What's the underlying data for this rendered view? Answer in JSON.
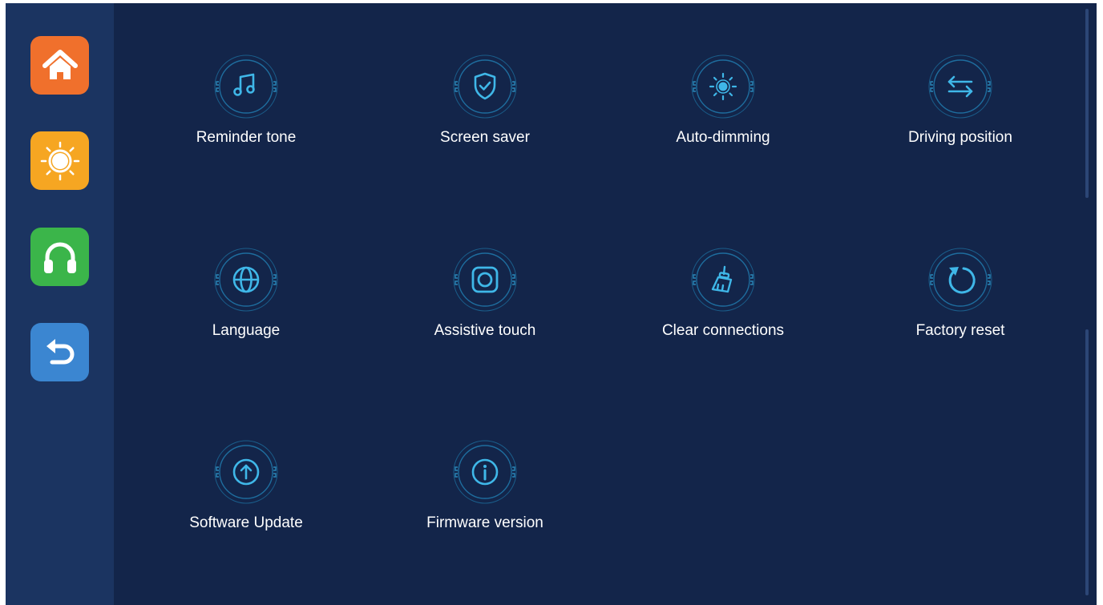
{
  "sidebar": {
    "buttons": [
      {
        "name": "home",
        "icon": "home-icon",
        "color": "#f0702c"
      },
      {
        "name": "brightness",
        "icon": "sun-icon",
        "color": "#f6a622"
      },
      {
        "name": "audio",
        "icon": "headphones-icon",
        "color": "#3bb54a"
      },
      {
        "name": "back",
        "icon": "back-arrow-icon",
        "color": "#3b86d1"
      }
    ]
  },
  "settings": {
    "items": [
      {
        "label": "Reminder tone",
        "icon": "music-note-icon"
      },
      {
        "label": "Screen saver",
        "icon": "shield-check-icon"
      },
      {
        "label": "Auto-dimming",
        "icon": "brightness-icon"
      },
      {
        "label": "Driving position",
        "icon": "swap-arrows-icon"
      },
      {
        "label": "Language",
        "icon": "globe-icon"
      },
      {
        "label": "Assistive touch",
        "icon": "assistive-touch-icon"
      },
      {
        "label": "Clear connections",
        "icon": "broom-icon"
      },
      {
        "label": "Factory reset",
        "icon": "reset-icon"
      },
      {
        "label": "Software Update",
        "icon": "upload-arrow-icon"
      },
      {
        "label": "Firmware version",
        "icon": "info-icon"
      }
    ]
  },
  "colors": {
    "background": "#13254a",
    "sidebar": "#1b3461",
    "accent": "#3fb7e8",
    "ring": "#1d6b9c"
  }
}
